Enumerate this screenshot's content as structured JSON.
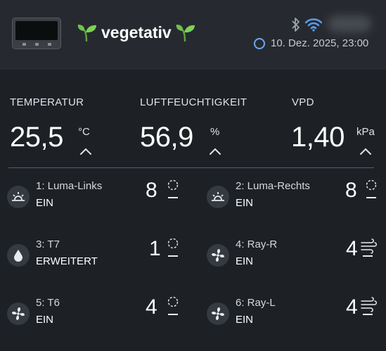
{
  "header": {
    "title": "vegetativ",
    "datetime": "10. Dez. 2025, 23:00",
    "icons": [
      "device-thumbnail",
      "sprout-icon",
      "bluetooth-icon",
      "wifi-icon",
      "clock-ring-icon"
    ]
  },
  "metrics": [
    {
      "label": "TEMPERATUR",
      "value": "25,5",
      "unit": "°C"
    },
    {
      "label": "LUFTFEUCHTIGKEIT",
      "value": "56,9",
      "unit": "%"
    },
    {
      "label": "VPD",
      "value": "1,40",
      "unit": "kPa"
    }
  ],
  "items": [
    {
      "name": "1: Luma-Links",
      "mode": "EIN",
      "value": "8",
      "icon": "sun-icon",
      "mark": "dashed-circle"
    },
    {
      "name": "2: Luma-Rechts",
      "mode": "EIN",
      "value": "8",
      "icon": "sun-icon",
      "mark": "dashed-circle"
    },
    {
      "name": "3: T7",
      "mode": "ERWEITERT",
      "value": "1",
      "icon": "droplet-icon",
      "mark": "dashed-circle"
    },
    {
      "name": "4: Ray-R",
      "mode": "EIN",
      "value": "4",
      "icon": "fan-icon",
      "mark": "wind-icon"
    },
    {
      "name": "5: T6",
      "mode": "EIN",
      "value": "4",
      "icon": "fan-icon",
      "mark": "dashed-circle"
    },
    {
      "name": "6: Ray-L",
      "mode": "EIN",
      "value": "4",
      "icon": "fan-icon",
      "mark": "wind-icon"
    }
  ],
  "colors": {
    "background": "#1d2126",
    "header": "#262a30",
    "accent": "#6aa9ee",
    "sprout": "#6fc24a"
  }
}
